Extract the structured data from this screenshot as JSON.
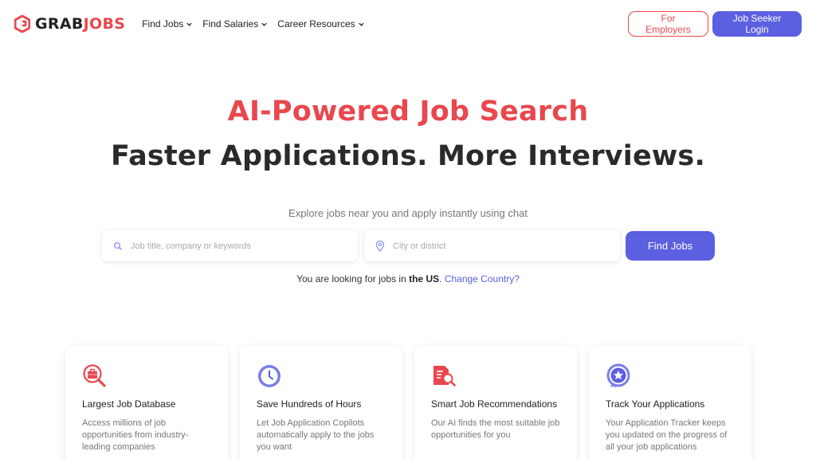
{
  "header": {
    "logo_grab": "GRAB",
    "logo_jobs": "JOBS",
    "nav": [
      {
        "label": "Find Jobs"
      },
      {
        "label": "Find Salaries"
      },
      {
        "label": "Career Resources"
      }
    ],
    "employers_label": "For Employers",
    "login_label": "Job Seeker Login"
  },
  "hero": {
    "title": "AI-Powered Job Search",
    "subtitle": "Faster Applications. More Interviews.",
    "description": "Explore jobs near you and apply instantly using chat"
  },
  "search": {
    "keywords_placeholder": "Job title, company or keywords",
    "keywords_value": "",
    "location_placeholder": "City or district",
    "location_value": "",
    "button_label": "Find Jobs"
  },
  "country": {
    "prefix": "You are looking for jobs in",
    "country": "the US",
    "suffix": ".",
    "change_label": "Change Country?"
  },
  "features": [
    {
      "icon": "job-database-icon",
      "title": "Largest Job Database",
      "description": "Access millions of job opportunities from industry-leading companies"
    },
    {
      "icon": "clock-icon",
      "title": "Save Hundreds of Hours",
      "description": "Let Job Application Copilots automatically apply to the jobs you want"
    },
    {
      "icon": "document-search-icon",
      "title": "Smart Job Recommendations",
      "description": "Our AI finds the most suitable job opportunities for you"
    },
    {
      "icon": "star-badge-icon",
      "title": "Track Your Applications",
      "description": "Your Application Tracker keeps you updated on the progress of all your job applications"
    }
  ],
  "colors": {
    "brand_red": "#e8484e",
    "brand_purple": "#5b60e0"
  }
}
